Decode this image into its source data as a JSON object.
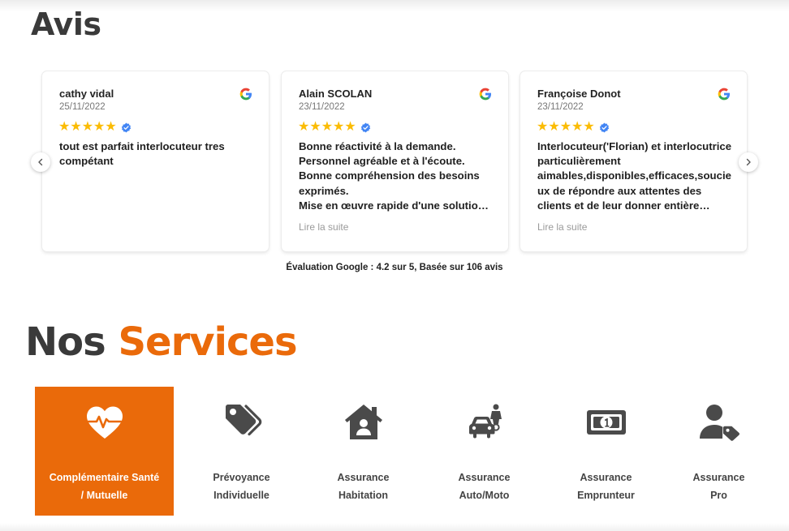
{
  "avis": {
    "title": "Avis",
    "reviews": [
      {
        "name": "cathy vidal",
        "date": "25/11/2022",
        "stars": 5,
        "text": "tout est parfait interlocuteur tres compétant",
        "more": ""
      },
      {
        "name": "Alain SCOLAN",
        "date": "23/11/2022",
        "stars": 5,
        "text": "Bonne réactivité à la demande.\nPersonnel agréable et à l'écoute.\nBonne compréhension des besoins exprimés.\nMise en œuvre rapide d'une solution adaptée.",
        "more": "Lire la suite"
      },
      {
        "name": "Françoise Donot",
        "date": "23/11/2022",
        "stars": 5,
        "text": "Interlocuteur('Florian) et interlocutrice particulièrement aimables,disponibles,efficaces,soucieux de répondre aux attentes des clients et de leur donner entière satisfaction.",
        "more": "Lire la suite"
      }
    ],
    "prev_icon": "chevron-left-icon",
    "next_icon": "chevron-right-icon",
    "rating_text": "Évaluation Google : 4.2 sur 5, Basée sur 106 avis"
  },
  "services": {
    "title_part1": "Nos",
    "title_part2": "Services",
    "accent_color": "#ea6a0a",
    "items": [
      {
        "line1": "Complémentaire Santé",
        "line2": "/ Mutuelle",
        "icon": "heart-pulse-icon",
        "active": true
      },
      {
        "line1": "Prévoyance",
        "line2": "Individuelle",
        "icon": "tags-icon",
        "active": false
      },
      {
        "line1": "Assurance",
        "line2": "Habitation",
        "icon": "house-user-icon",
        "active": false
      },
      {
        "line1": "Assurance",
        "line2": "Auto/Moto",
        "icon": "car-motorcycle-icon",
        "active": false
      },
      {
        "line1": "Assurance",
        "line2": "Emprunteur",
        "icon": "money-bill-icon",
        "active": false
      },
      {
        "line1": "Assurance",
        "line2": "Pro",
        "icon": "user-tag-icon",
        "active": false
      }
    ]
  }
}
